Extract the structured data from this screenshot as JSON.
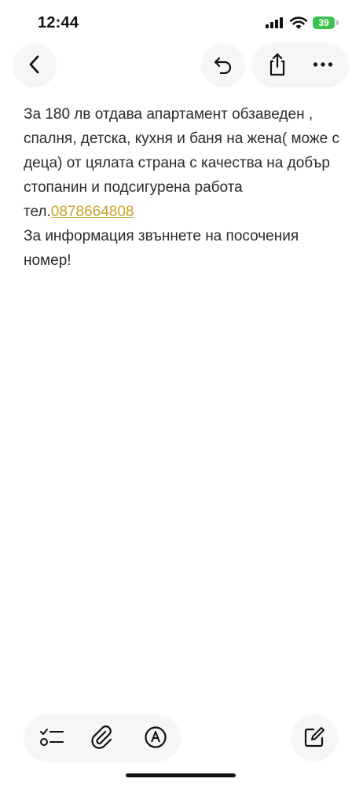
{
  "status_bar": {
    "time": "12:44",
    "battery_level": "39",
    "battery_color": "#3bc24f"
  },
  "nav": {
    "back_icon": "chevron-left-icon",
    "undo_icon": "undo-icon",
    "share_icon": "share-icon",
    "more_icon": "more-horizontal-icon"
  },
  "note": {
    "text_part1": "За 180 лв отдава апартамент обзаведен , спалня, детска, кухня и баня на жена( може с деца) от цялата страна с качества на добър стопанин и подсигурена работа тел.",
    "phone": "0878664808",
    "text_part2": "За информация звъннете на посочения номер!",
    "link_color": "#c9a227"
  },
  "toolbar": {
    "checklist_icon": "checklist-icon",
    "attachment_icon": "paperclip-icon",
    "markup_icon": "markup-pen-icon",
    "compose_icon": "compose-icon"
  }
}
